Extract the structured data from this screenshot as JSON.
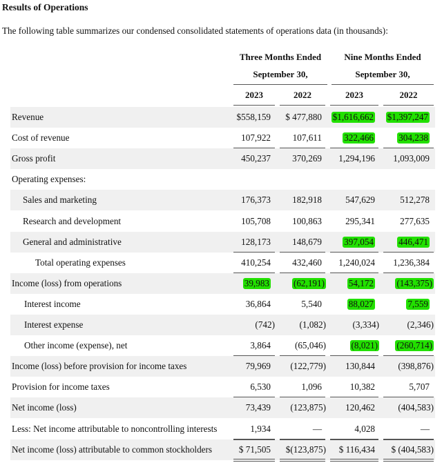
{
  "heading": "Results of Operations",
  "intro": "The following table summarizes our condensed consolidated statements of operations data (in thousands):",
  "column_groups": [
    {
      "line1": "Three Months Ended",
      "line2": "September 30,"
    },
    {
      "line1": "Nine Months Ended",
      "line2": "September 30,"
    }
  ],
  "years": [
    "2023",
    "2022",
    "2023",
    "2022"
  ],
  "highlight_color": "#22e000",
  "rows": [
    {
      "label": "Revenue",
      "values": [
        "$558,159",
        "$ 477,880",
        "$1,616,662",
        "$1,397,247"
      ],
      "highlight": [
        false,
        false,
        true,
        true
      ]
    },
    {
      "label": "Cost of revenue",
      "values": [
        "107,922",
        "107,611",
        "322,466",
        "304,238"
      ],
      "highlight": [
        false,
        false,
        true,
        true
      ]
    },
    {
      "label": "Gross profit",
      "values": [
        "450,237",
        "370,269",
        "1,294,196",
        "1,093,009"
      ],
      "highlight": [
        false,
        false,
        false,
        false
      ]
    },
    {
      "label": "Operating expenses:",
      "values": [
        "",
        "",
        "",
        ""
      ],
      "highlight": [
        false,
        false,
        false,
        false
      ]
    },
    {
      "label": "Sales and marketing",
      "values": [
        "176,373",
        "182,918",
        "547,629",
        "512,278"
      ],
      "highlight": [
        false,
        false,
        false,
        false
      ]
    },
    {
      "label": "Research and development",
      "values": [
        "105,708",
        "100,863",
        "295,341",
        "277,635"
      ],
      "highlight": [
        false,
        false,
        false,
        false
      ]
    },
    {
      "label": "General and administrative",
      "values": [
        "128,173",
        "148,679",
        "397,054",
        "446,471"
      ],
      "highlight": [
        false,
        false,
        true,
        true
      ]
    },
    {
      "label": "Total operating expenses",
      "values": [
        "410,254",
        "432,460",
        "1,240,024",
        "1,236,384"
      ],
      "highlight": [
        false,
        false,
        false,
        false
      ]
    },
    {
      "label": "Income (loss) from operations",
      "values": [
        "39,983",
        "(62,191)",
        "54,172",
        "(143,375)"
      ],
      "highlight": [
        true,
        true,
        true,
        true
      ]
    },
    {
      "label": "Interest income",
      "values": [
        "36,864",
        "5,540",
        "88,027",
        "7,559"
      ],
      "highlight": [
        false,
        false,
        true,
        true
      ]
    },
    {
      "label": "Interest expense",
      "values": [
        "(742)",
        "(1,082)",
        "(3,334)",
        "(2,346)"
      ],
      "highlight": [
        false,
        false,
        false,
        false
      ]
    },
    {
      "label": "Other income (expense), net",
      "values": [
        "3,864",
        "(65,046)",
        "(8,021)",
        "(260,714)"
      ],
      "highlight": [
        false,
        false,
        true,
        true
      ]
    },
    {
      "label": "Income (loss) before provision for income taxes",
      "values": [
        "79,969",
        "(122,779)",
        "130,844",
        "(398,876)"
      ],
      "highlight": [
        false,
        false,
        false,
        false
      ]
    },
    {
      "label": "Provision for income taxes",
      "values": [
        "6,530",
        "1,096",
        "10,382",
        "5,707"
      ],
      "highlight": [
        false,
        false,
        false,
        false
      ]
    },
    {
      "label": "Net income (loss)",
      "values": [
        "73,439",
        "(123,875)",
        "120,462",
        "(404,583)"
      ],
      "highlight": [
        false,
        false,
        false,
        false
      ]
    },
    {
      "label": "Less: Net income attributable to noncontrolling interests",
      "values": [
        "1,934",
        "—",
        "4,028",
        "—"
      ],
      "highlight": [
        false,
        false,
        false,
        false
      ]
    },
    {
      "label": "Net income (loss) attributable to common stockholders",
      "values": [
        "$ 71,505",
        "$(123,875)",
        "$ 116,434",
        "$ (404,583)"
      ],
      "highlight": [
        false,
        false,
        false,
        false
      ]
    }
  ]
}
